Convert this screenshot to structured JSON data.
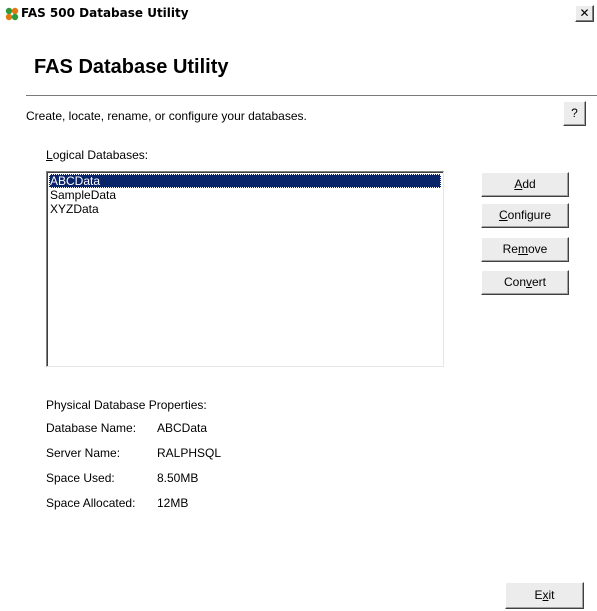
{
  "window": {
    "title": "FAS 500 Database Utility",
    "close_glyph": "✕"
  },
  "header": {
    "title": "FAS Database Utility"
  },
  "description": "Create, locate, rename, or configure your databases.",
  "help_button": "?",
  "logical_databases": {
    "label_underline": "L",
    "label_rest": "ogical Databases:",
    "items": [
      "ABCData",
      "SampleData",
      "XYZData"
    ],
    "selected": "ABCData"
  },
  "buttons": {
    "add": {
      "pre": "",
      "mnemonic": "A",
      "post": "dd"
    },
    "configure": {
      "pre": "",
      "mnemonic": "C",
      "post": "onfigure"
    },
    "remove": {
      "pre": "Re",
      "mnemonic": "m",
      "post": "ove"
    },
    "convert": {
      "pre": "Con",
      "mnemonic": "v",
      "post": "ert"
    },
    "exit": {
      "pre": "E",
      "mnemonic": "x",
      "post": "it"
    }
  },
  "physical_properties": {
    "heading": "Physical Database Properties:",
    "rows": [
      {
        "label": "Database Name:",
        "value": "ABCData"
      },
      {
        "label": "Server Name:",
        "value": "RALPHSQL"
      },
      {
        "label": "Space Used:",
        "value": "8.50MB"
      },
      {
        "label": "Space Allocated:",
        "value": "12MB"
      }
    ]
  },
  "icons": {
    "app": "fas-app-icon"
  },
  "colors": {
    "selection": "#0a246a",
    "app_icon_green": "#2e9a3a",
    "app_icon_orange": "#e07a10"
  }
}
